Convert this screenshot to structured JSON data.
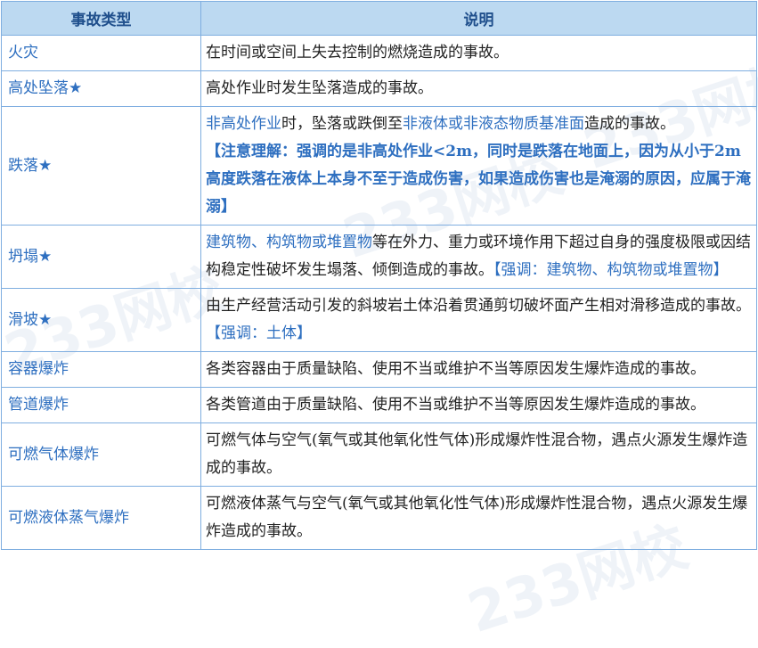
{
  "watermark": "233网校",
  "header": {
    "type": "事故类型",
    "desc": "说明"
  },
  "rows": [
    {
      "type": "火灾",
      "segments": [
        {
          "text": "在时间或空间上失去控制的燃烧造成的事故。",
          "style": "plain"
        }
      ]
    },
    {
      "type": "高处坠落★",
      "segments": [
        {
          "text": "高处作业时发生坠落造成的事故。",
          "style": "plain"
        }
      ]
    },
    {
      "type": "跌落★",
      "segments": [
        {
          "text": "非高处作业",
          "style": "hl"
        },
        {
          "text": "时，坠落或跌倒至",
          "style": "plain"
        },
        {
          "text": "非液体或非液态物质基准面",
          "style": "hl"
        },
        {
          "text": "造成的事故。",
          "style": "plain"
        },
        {
          "text": "【注意理解：强调的是非高处作业<2m，同时是跌落在地面上，因为从小于2m高度跌落在液体上本身不至于造成伤害，如果造成伤害也是淹溺的原因，应属于淹溺】",
          "style": "hl-bold",
          "block": true
        }
      ]
    },
    {
      "type": "坍塌★",
      "segments": [
        {
          "text": "建筑物、构筑物或堆置物",
          "style": "hl"
        },
        {
          "text": "等在外力、重力或环境作用下超过自身的强度极限或因结构稳定性破坏发生塌落、倾倒造成的事故。",
          "style": "plain"
        },
        {
          "text": "【强调：建筑物、构筑物或堆置物】",
          "style": "hl"
        }
      ]
    },
    {
      "type": "滑坡★",
      "segments": [
        {
          "text": "由生产经营活动引发的斜坡岩土体沿着贯通剪切破坏面产生相对滑移造成的事故。",
          "style": "plain"
        },
        {
          "text": "【强调：土体】",
          "style": "hl",
          "block": true
        }
      ]
    },
    {
      "type": "容器爆炸",
      "segments": [
        {
          "text": "各类容器由于质量缺陷、使用不当或维护不当等原因发生爆炸造成的事故。",
          "style": "plain"
        }
      ]
    },
    {
      "type": "管道爆炸",
      "segments": [
        {
          "text": "各类管道由于质量缺陷、使用不当或维护不当等原因发生爆炸造成的事故。",
          "style": "plain"
        }
      ]
    },
    {
      "type": "可燃气体爆炸",
      "segments": [
        {
          "text": "可燃气体与空气(氧气或其他氧化性气体)形成爆炸性混合物，遇点火源发生爆炸造成的事故。",
          "style": "plain"
        }
      ]
    },
    {
      "type": "可燃液体蒸气爆炸",
      "segments": [
        {
          "text": "可燃液体蒸气与空气(氧气或其他氧化性气体)形成爆炸性混合物，遇点火源发生爆炸造成的事故。",
          "style": "plain"
        }
      ]
    }
  ]
}
